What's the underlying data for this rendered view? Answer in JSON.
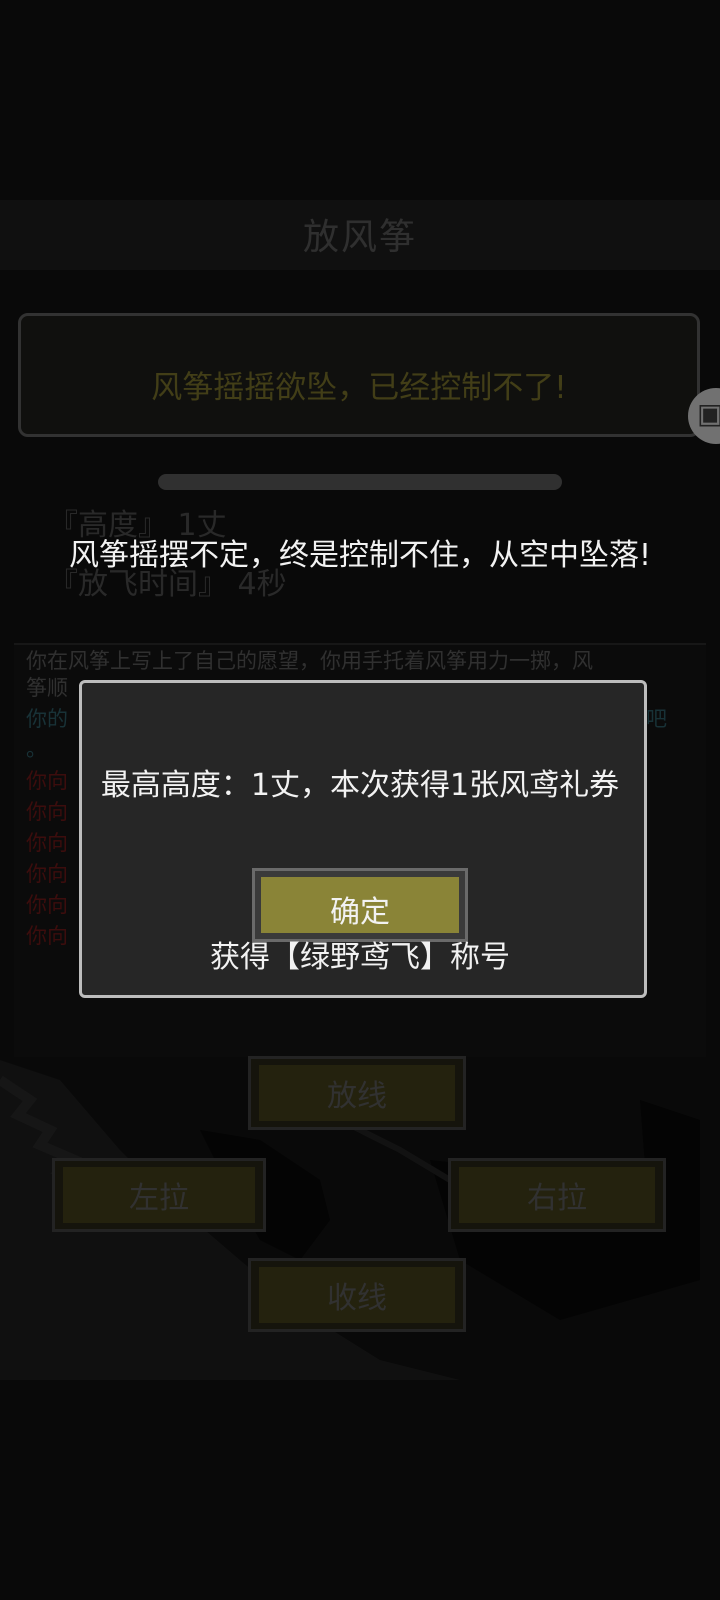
{
  "screen": {
    "title": "放风筝",
    "status": "风筝摇摇欲坠，已经控制不了!",
    "stats": {
      "height": "『高度』 1丈",
      "flight_time": "『放飞时间』 4秒"
    },
    "log": [
      {
        "text": "你在风筝上写上了自己的愿望，你用手托着风筝用力一掷，风",
        "color": "#3b3b3b"
      },
      {
        "text": "筝顺",
        "color": "#3b3b3b"
      },
      {
        "text": "你的",
        "color": "#1e3d44",
        "tail": "吧"
      },
      {
        "text": "。",
        "color": "#1e3d44"
      },
      {
        "text": "你向",
        "color": "#4a1010"
      },
      {
        "text": "你向",
        "color": "#4a1010"
      },
      {
        "text": "你向",
        "color": "#4a1010"
      },
      {
        "text": "你向",
        "color": "#4a1010"
      },
      {
        "text": "你向",
        "color": "#4a1010"
      },
      {
        "text": "你向",
        "color": "#4a1010"
      }
    ],
    "controls": {
      "release": "放线",
      "left": "左拉",
      "right": "右拉",
      "reel": "收线"
    }
  },
  "toast": "风筝摇摆不定，终是控制不住，从空中坠落!",
  "dialog": {
    "message": "最高高度：1丈，本次获得1张风鸢礼券",
    "confirm": "确定",
    "award": "获得【绿野鸢飞】称号"
  },
  "colors": {
    "accent": "#8a8437",
    "dialog_border": "#bdbdbd"
  }
}
